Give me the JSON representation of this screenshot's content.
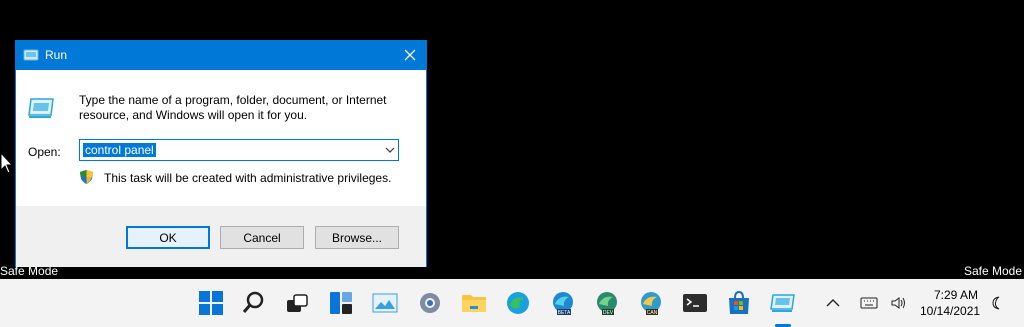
{
  "background": {
    "safe_mode_left": "Safe Mode",
    "safe_mode_right": "Safe Mode"
  },
  "dialog": {
    "title": "Run",
    "description": "Type the name of a program, folder, document, or Internet resource, and Windows will open it for you.",
    "open_label": "Open:",
    "open_value": "control panel",
    "admin_note": "This task will be created with administrative privileges.",
    "buttons": {
      "ok": "OK",
      "cancel": "Cancel",
      "browse": "Browse..."
    }
  },
  "taskbar": {
    "apps": [
      "start-icon",
      "search-icon",
      "task-view-icon",
      "widgets-icon",
      "photos-icon",
      "settings-icon",
      "file-explorer-icon",
      "edge-icon",
      "edge-beta-icon",
      "edge-dev-icon",
      "edge-canary-icon",
      "terminal-icon",
      "store-icon",
      "run-icon"
    ],
    "tray": {
      "time": "7:29 AM",
      "date": "10/14/2021"
    }
  },
  "colors": {
    "accent": "#0078d7",
    "taskbar": "#f3f3f3",
    "dialog_footer": "#f0f0f0"
  }
}
